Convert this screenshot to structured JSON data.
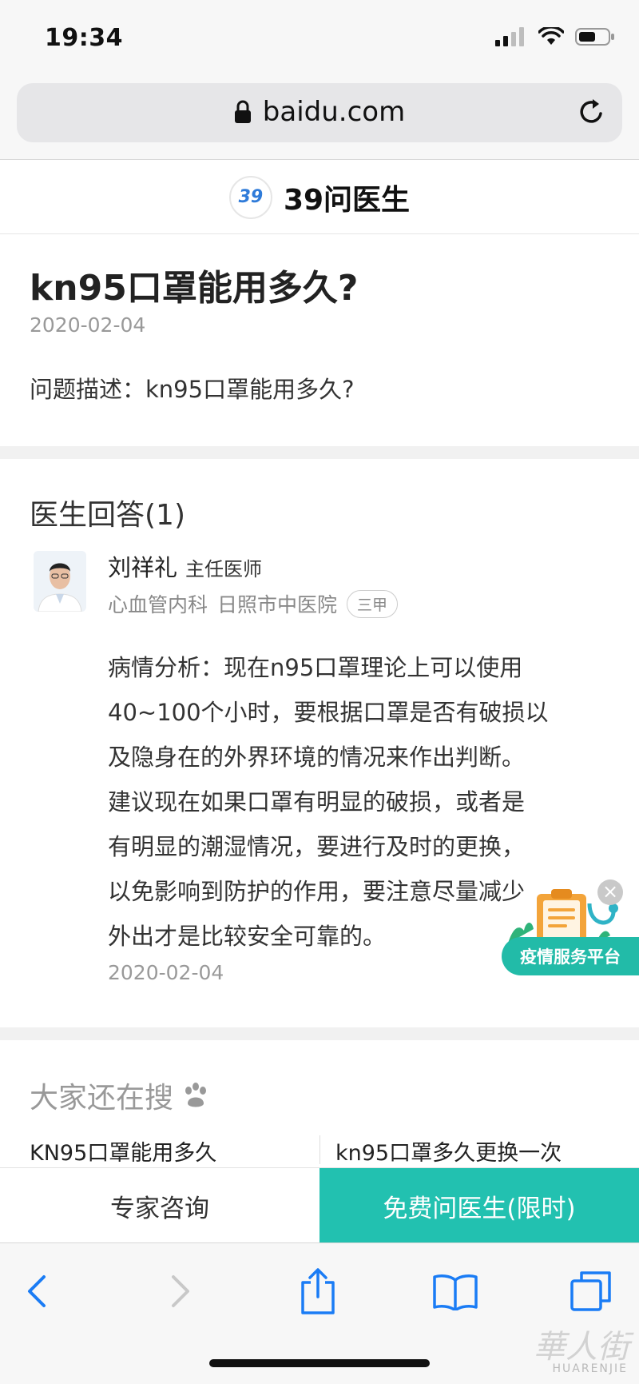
{
  "status_bar": {
    "time": "19:34"
  },
  "browser": {
    "url": "baidu.com"
  },
  "site": {
    "name": "39问医生",
    "logo_text": "39"
  },
  "question": {
    "title": "kn95口罩能用多久?",
    "date": "2020-02-04",
    "description": "问题描述：kn95口罩能用多久?"
  },
  "answers": {
    "heading": "医生回答(1)",
    "doctor": {
      "name": "刘祥礼",
      "title": "主任医师",
      "department": "心血管内科",
      "hospital": "日照市中医院",
      "hospital_level": "三甲"
    },
    "body_lines": [
      "病情分析：现在n95口罩理论上可以使用",
      "40~100个小时，要根据口罩是否有破损以",
      "及隐身在的外界环境的情况来作出判断。",
      "建议现在如果口罩有明显的破损，或者是",
      "有明显的潮湿情况，要进行及时的更换，",
      "以免影响到防护的作用，要注意尽量减少",
      "外出才是比较安全可靠的。"
    ],
    "date": "2020-02-04"
  },
  "float_ad": {
    "label": "疫情服务平台",
    "close": "×"
  },
  "also_search": {
    "heading": "大家还在搜",
    "items": [
      "KN95口罩能用多久",
      "kn95口罩多久更换一次"
    ]
  },
  "action_bar": {
    "consult": "专家咨询",
    "free_ask": "免费问医生(限时)"
  },
  "watermark": {
    "text": "華人街",
    "sub": "HUARENJIE"
  },
  "colors": {
    "accent": "#22c1b0",
    "link_blue": "#1a7cf5"
  }
}
